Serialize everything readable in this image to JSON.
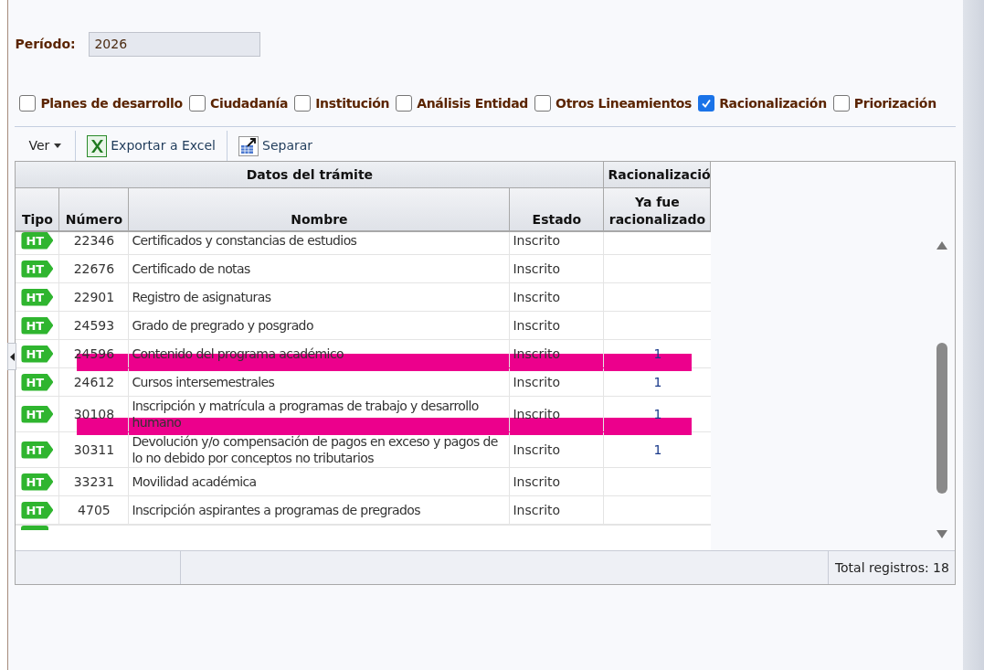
{
  "period": {
    "label": "Período:",
    "value": "2026"
  },
  "filters": [
    {
      "label": "Planes de desarrollo",
      "checked": false
    },
    {
      "label": "Ciudadanía",
      "checked": false
    },
    {
      "label": "Institución",
      "checked": false
    },
    {
      "label": "Análisis Entidad",
      "checked": false
    },
    {
      "label": "Otros Lineamientos",
      "checked": false
    },
    {
      "label": "Racionalización",
      "checked": true
    },
    {
      "label": "Priorización",
      "checked": false
    }
  ],
  "toolbar": [
    {
      "kind": "menu",
      "label": "Ver"
    },
    {
      "kind": "excel",
      "label": "Exportar a Excel"
    },
    {
      "kind": "split",
      "label": "Separar"
    }
  ],
  "table": {
    "groups": [
      {
        "label": "Datos del trámite"
      },
      {
        "label": "Racionalizació"
      }
    ],
    "columns": [
      "Tipo",
      "Número",
      "Nombre",
      "Estado",
      "Ya fue racionalizado"
    ],
    "rows": [
      {
        "tipo": "HT",
        "numero": "22346",
        "nombre": "Certificados y constancias de estudios",
        "estado": "Inscrito",
        "racionalizado": "",
        "highlighted": false
      },
      {
        "tipo": "HT",
        "numero": "22676",
        "nombre": "Certificado de notas",
        "estado": "Inscrito",
        "racionalizado": "",
        "highlighted": false
      },
      {
        "tipo": "HT",
        "numero": "22901",
        "nombre": "Registro de asignaturas",
        "estado": "Inscrito",
        "racionalizado": "",
        "highlighted": false
      },
      {
        "tipo": "HT",
        "numero": "24593",
        "nombre": "Grado de pregrado y posgrado",
        "estado": "Inscrito",
        "racionalizado": "",
        "highlighted": false
      },
      {
        "tipo": "HT",
        "numero": "24596",
        "nombre": "Contenido del programa académico",
        "estado": "Inscrito",
        "racionalizado": "1",
        "highlighted": true
      },
      {
        "tipo": "HT",
        "numero": "24612",
        "nombre": "Cursos intersemestrales",
        "estado": "Inscrito",
        "racionalizado": "1",
        "highlighted": false
      },
      {
        "tipo": "HT",
        "numero": "30108",
        "nombre": "Inscripción y matrícula a programas de trabajo y desarrollo humano",
        "estado": "Inscrito",
        "racionalizado": "1",
        "highlighted": true
      },
      {
        "tipo": "HT",
        "numero": "30311",
        "nombre": "Devolución y/o compensación de pagos en exceso y pagos de lo no debido por conceptos no tributarios",
        "estado": "Inscrito",
        "racionalizado": "1",
        "highlighted": false
      },
      {
        "tipo": "HT",
        "numero": "33231",
        "nombre": "Movilidad académica",
        "estado": "Inscrito",
        "racionalizado": "",
        "highlighted": false
      },
      {
        "tipo": "HT",
        "numero": "4705",
        "nombre": "Inscripción aspirantes a programas de pregrados",
        "estado": "Inscrito",
        "racionalizado": "",
        "highlighted": false
      }
    ],
    "total": "Total registros: 18"
  }
}
